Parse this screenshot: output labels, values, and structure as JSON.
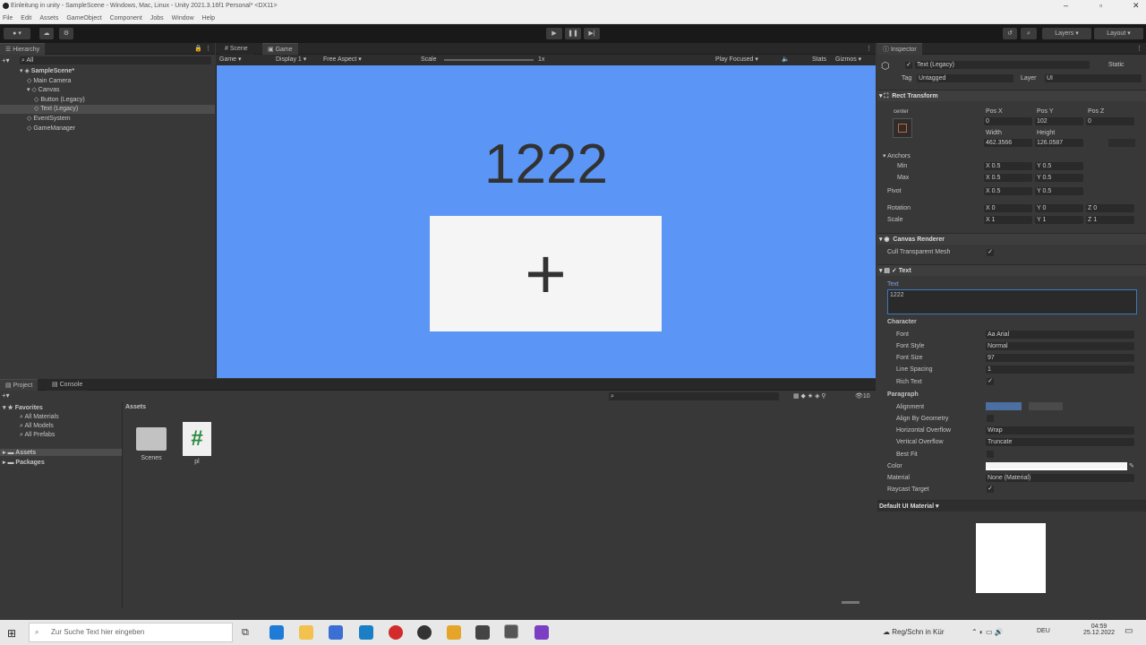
{
  "window": {
    "title": "Einleitung in unity - SampleScene - Windows, Mac, Linux - Unity 2021.3.16f1 Personal* <DX11>"
  },
  "menu": [
    "File",
    "Edit",
    "Assets",
    "GameObject",
    "Component",
    "Jobs",
    "Window",
    "Help"
  ],
  "toolbar": {
    "layers": "Layers",
    "layout": "Layout"
  },
  "hierarchy": {
    "tab": "Hierarchy",
    "search_placeholder": "All",
    "items": [
      {
        "label": "SampleScene*",
        "indent": 0
      },
      {
        "label": "Main Camera",
        "indent": 1
      },
      {
        "label": "Canvas",
        "indent": 1
      },
      {
        "label": "Button (Legacy)",
        "indent": 2
      },
      {
        "label": "Text (Legacy)",
        "indent": 2
      },
      {
        "label": "EventSystem",
        "indent": 1
      },
      {
        "label": "GameManager",
        "indent": 1
      }
    ]
  },
  "gameview": {
    "tabs": [
      "Scene",
      "Game"
    ],
    "display_mode": "Game",
    "display": "Display 1",
    "aspect": "Free Aspect",
    "scale_label": "Scale",
    "scale_value": "1x",
    "play_mode": "Play Focused",
    "stats": "Stats",
    "gizmos": "Gizmos",
    "counter_text": "1222",
    "button_glyph": "+"
  },
  "inspector": {
    "tab": "Inspector",
    "object_name": "Text (Legacy)",
    "static_label": "Static",
    "tag_label": "Tag",
    "tag_value": "Untagged",
    "layer_label": "Layer",
    "layer_value": "UI",
    "rect_transform": {
      "title": "Rect Transform",
      "anchor_preset": "center",
      "pos_x_label": "Pos X",
      "pos_x": "0",
      "pos_y_label": "Pos Y",
      "pos_y": "102",
      "pos_z_label": "Pos Z",
      "pos_z": "0",
      "width_label": "Width",
      "width": "462.3566",
      "height_label": "Height",
      "height": "126.0587",
      "anchors_label": "Anchors",
      "min_label": "Min",
      "min_x": "0.5",
      "min_y": "0.5",
      "max_label": "Max",
      "max_x": "0.5",
      "max_y": "0.5",
      "pivot_label": "Pivot",
      "pivot_x": "0.5",
      "pivot_y": "0.5",
      "rotation_label": "Rotation",
      "rot_x": "0",
      "rot_y": "0",
      "rot_z": "0",
      "scale_label": "Scale",
      "scale_x": "1",
      "scale_y": "1",
      "scale_z": "1"
    },
    "canvas_renderer": {
      "title": "Canvas Renderer",
      "cull_label": "Cull Transparent Mesh"
    },
    "text": {
      "title": "Text",
      "text_label": "Text",
      "text_value": "1222",
      "character_label": "Character",
      "font_label": "Font",
      "font_value": "Arial",
      "font_style_label": "Font Style",
      "font_style_value": "Normal",
      "font_size_label": "Font Size",
      "font_size_value": "97",
      "line_spacing_label": "Line Spacing",
      "line_spacing_value": "1",
      "rich_text_label": "Rich Text",
      "paragraph_label": "Paragraph",
      "alignment_label": "Alignment",
      "align_geometry_label": "Align By Geometry",
      "h_overflow_label": "Horizontal Overflow",
      "h_overflow_value": "Wrap",
      "v_overflow_label": "Vertical Overflow",
      "v_overflow_value": "Truncate",
      "best_fit_label": "Best Fit",
      "color_label": "Color",
      "material_label": "Material",
      "material_value": "None (Material)",
      "raycast_label": "Raycast Target"
    },
    "default_material": "Default UI Material"
  },
  "project": {
    "tabs": [
      "Project",
      "Console"
    ],
    "favorites_label": "Favorites",
    "favorites": [
      "All Materials",
      "All Models",
      "All Prefabs"
    ],
    "roots": [
      "Assets",
      "Packages"
    ],
    "assets_header": "Assets",
    "assets": [
      {
        "name": "Scenes",
        "type": "folder-icon"
      },
      {
        "name": "pl",
        "type": "csharp-script-icon"
      }
    ],
    "hidden_count": "10"
  },
  "taskbar": {
    "search_placeholder": "Zur Suche Text hier eingeben",
    "weather": "Reg/Schn in Kür",
    "lang": "DEU",
    "time": "04:59",
    "date": "25.12.2022"
  },
  "colors": {
    "game_bg": "#5b95f5",
    "editor_bg": "#383838",
    "button_bg": "#f5f5f5"
  }
}
